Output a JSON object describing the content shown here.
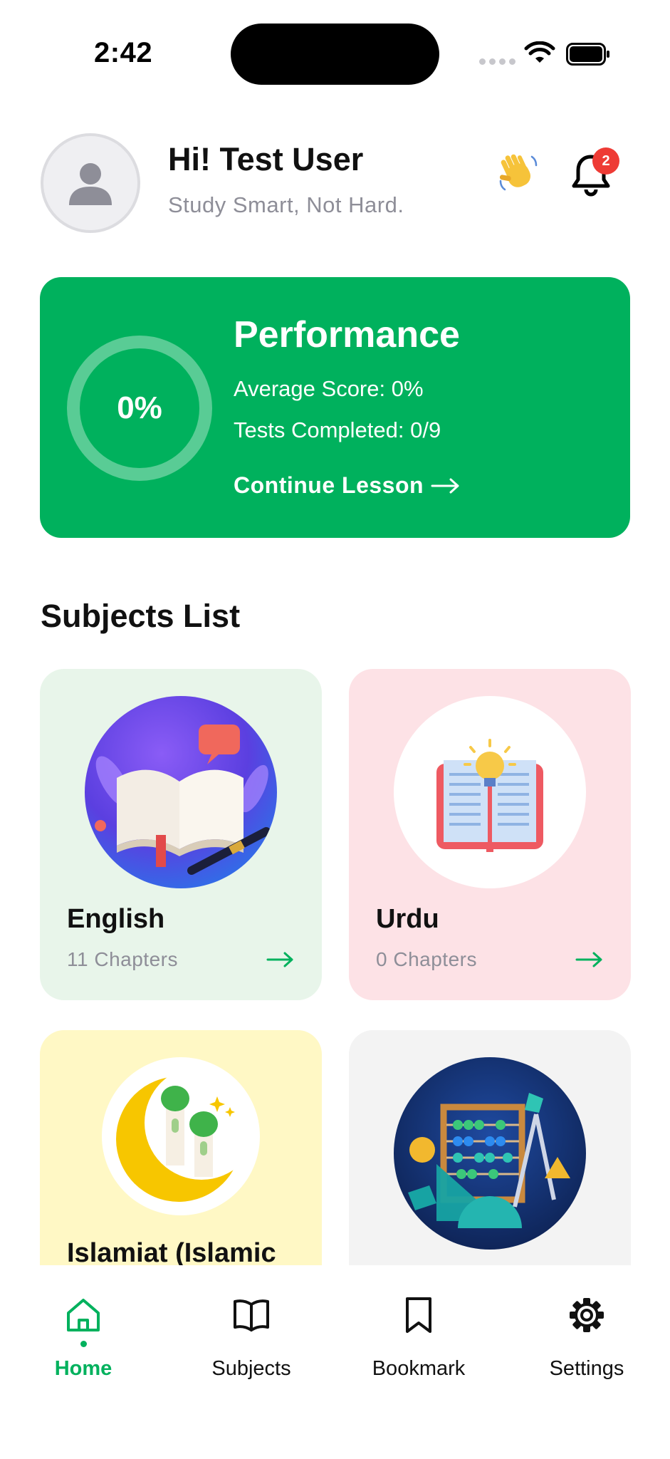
{
  "status_bar": {
    "time": "2:42"
  },
  "header": {
    "greeting": "Hi! Test User",
    "tagline": "Study Smart, Not Hard.",
    "notification_count": "2"
  },
  "performance": {
    "percent_label": "0%",
    "progress_fraction": 0,
    "title": "Performance",
    "average_score": "Average Score: 0%",
    "tests_completed": "Tests Completed: 0/9",
    "continue_label": "Continue Lesson"
  },
  "subjects_section": {
    "title": "Subjects List"
  },
  "subjects": [
    {
      "name": "English",
      "chapters": "11 Chapters"
    },
    {
      "name": "Urdu",
      "chapters": "0 Chapters"
    },
    {
      "name": "Islamiat (Islamic",
      "chapters": ""
    },
    {
      "name": "",
      "chapters": ""
    }
  ],
  "tabbar": {
    "tabs": [
      {
        "label": "Home",
        "icon": "home-icon",
        "active": true
      },
      {
        "label": "Subjects",
        "icon": "book-open-icon",
        "active": false
      },
      {
        "label": "Bookmark",
        "icon": "bookmark-icon",
        "active": false
      },
      {
        "label": "Settings",
        "icon": "gear-icon",
        "active": false
      }
    ]
  },
  "colors": {
    "accent": "#00b15d",
    "english_card": "#e8f5ea",
    "urdu_card": "#fde2e6",
    "islamiat_card": "#fff8c5",
    "math_card": "#f3f3f3",
    "badge": "#ee3b35"
  }
}
